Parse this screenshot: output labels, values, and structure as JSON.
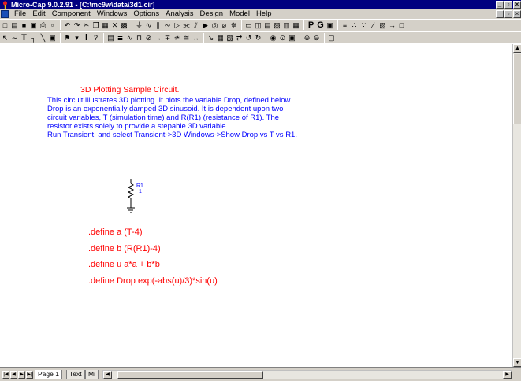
{
  "window": {
    "title": "Micro-Cap 9.0.2.91 - [C:\\mc9w\\data\\3d1.cir]",
    "buttons": [
      "_",
      "×"
    ]
  },
  "menubar": {
    "items": [
      "File",
      "Edit",
      "Component",
      "Windows",
      "Options",
      "Analysis",
      "Design",
      "Model",
      "Help"
    ],
    "mdi_buttons": [
      "_",
      "×"
    ]
  },
  "toolbar1": {
    "buttons": [
      {
        "name": "new-icon",
        "glyph": "□"
      },
      {
        "name": "open-icon",
        "glyph": "▤"
      },
      {
        "name": "save-icon",
        "glyph": "■"
      },
      {
        "name": "save-all-icon",
        "glyph": "▣"
      },
      {
        "name": "print-icon",
        "glyph": "⎙"
      },
      {
        "name": "print-preview-icon",
        "glyph": "▫"
      },
      {
        "name": "undo-icon",
        "glyph": "↶"
      },
      {
        "name": "redo-icon",
        "glyph": "↷"
      },
      {
        "name": "cut-icon",
        "glyph": "✂"
      },
      {
        "name": "copy-icon",
        "glyph": "❐"
      },
      {
        "name": "paste-icon",
        "glyph": "▦"
      },
      {
        "name": "delete-icon",
        "glyph": "✕"
      },
      {
        "name": "select-all-icon",
        "glyph": "▩"
      },
      {
        "name": "ground-icon",
        "glyph": "⏚"
      },
      {
        "name": "resistor-icon",
        "glyph": "∿"
      },
      {
        "name": "capacitor-icon",
        "glyph": "∥"
      },
      {
        "name": "inductor-icon",
        "glyph": "∾"
      },
      {
        "name": "diode-icon",
        "glyph": "▷"
      },
      {
        "name": "battery-icon",
        "glyph": "⫘"
      },
      {
        "name": "npn-icon",
        "glyph": "⫽"
      },
      {
        "name": "opamp-icon",
        "glyph": "▶"
      },
      {
        "name": "source-icon",
        "glyph": "◎"
      },
      {
        "name": "switch-icon",
        "glyph": "⌀"
      },
      {
        "name": "component-icon",
        "glyph": "✵"
      },
      {
        "name": "window-icon",
        "glyph": "▭"
      },
      {
        "name": "tile-icon",
        "glyph": "◫"
      },
      {
        "name": "cascade-icon",
        "glyph": "▤"
      },
      {
        "name": "component-browser-icon",
        "glyph": "▧"
      },
      {
        "name": "text-window-icon",
        "glyph": "▥"
      },
      {
        "name": "calculator-icon",
        "glyph": "▦"
      },
      {
        "name": "pin-icon",
        "glyph": "P",
        "bold": true
      },
      {
        "name": "grid-icon",
        "glyph": "G",
        "bold": true
      },
      {
        "name": "border-icon",
        "glyph": "▣"
      },
      {
        "name": "attribute-icon",
        "glyph": "≡"
      },
      {
        "name": "node-numbers-icon",
        "glyph": "∴"
      },
      {
        "name": "node-voltage-icon",
        "glyph": "∵"
      },
      {
        "name": "pin-marker-icon",
        "glyph": "∕"
      },
      {
        "name": "grid-text-icon",
        "glyph": "▨"
      },
      {
        "name": "current-icon",
        "glyph": "→"
      },
      {
        "name": "power-icon",
        "glyph": "□"
      }
    ]
  },
  "toolbar2": {
    "buttons": [
      {
        "name": "select-mode-icon",
        "glyph": "↖"
      },
      {
        "name": "wire-mode-icon",
        "glyph": "∼"
      },
      {
        "name": "text-mode-icon",
        "glyph": "T",
        "bold": true
      },
      {
        "name": "wire-icon",
        "glyph": "┐"
      },
      {
        "name": "diagonal-wire-icon",
        "glyph": "╲"
      },
      {
        "name": "info-mode-icon",
        "glyph": "▣"
      },
      {
        "name": "flag-icon",
        "glyph": "⚑"
      },
      {
        "name": "point-to-point-icon",
        "glyph": "▾"
      },
      {
        "name": "info-icon",
        "glyph": "i",
        "bold": true
      },
      {
        "name": "help-icon",
        "glyph": "?"
      },
      {
        "name": "step-icon",
        "glyph": "▤"
      },
      {
        "name": "text-icon",
        "glyph": "≣"
      },
      {
        "name": "waveform-icon",
        "glyph": "∿"
      },
      {
        "name": "pulse-icon",
        "glyph": "⊓"
      },
      {
        "name": "probe-icon",
        "glyph": "⊘"
      },
      {
        "name": "goal-icon",
        "glyph": "→"
      },
      {
        "name": "plus-icon",
        "glyph": "∓"
      },
      {
        "name": "tran-icon",
        "glyph": "≄"
      },
      {
        "name": "ac-icon",
        "glyph": "≅"
      },
      {
        "name": "dc-icon",
        "glyph": "↔"
      },
      {
        "name": "rotate-icon",
        "glyph": "↘"
      },
      {
        "name": "mirror-icon",
        "glyph": "▦"
      },
      {
        "name": "flip-icon",
        "glyph": "▧"
      },
      {
        "name": "undo-flip-icon",
        "glyph": "⇄"
      },
      {
        "name": "rotate-left-icon",
        "glyph": "↺"
      },
      {
        "name": "rotate-right-icon",
        "glyph": "↻"
      },
      {
        "name": "find-icon",
        "glyph": "◉"
      },
      {
        "name": "binoculars-icon",
        "glyph": "⊙"
      },
      {
        "name": "property-icon",
        "glyph": "▣"
      },
      {
        "name": "zoom-in-icon",
        "glyph": "⊕"
      },
      {
        "name": "zoom-out-icon",
        "glyph": "⊖"
      },
      {
        "name": "camera-icon",
        "glyph": "▢"
      }
    ]
  },
  "document": {
    "title": "3D Plotting Sample Circuit.",
    "description": [
      "This circuit illustrates 3D plotting. It plots the variable Drop, defined below.",
      "Drop is an exponentially damped 3D sinusoid.  It is dependent upon two",
      "circuit variables, T (simulation time) and R(R1) (resistance of R1). The",
      "resistor exists solely to provide a stepable 3D variable.",
      "Run Transient, and select Transient->3D Windows->Show Drop vs T vs R1."
    ],
    "resistor_label": "R1",
    "resistor_node": "1",
    "defines": [
      ".define a (T-4)",
      ".define b (R(R1)-4)",
      ".define u a*a + b*b",
      ".define Drop exp(-abs(u)/3)*sin(u)"
    ]
  },
  "bottom": {
    "nav": [
      "|◀",
      "◀",
      "▶",
      "▶|"
    ],
    "tabs": [
      "Page 1",
      "Text",
      "Mi"
    ]
  },
  "colors": {
    "title_red": "#ff0000",
    "text_blue": "#0000ff",
    "titlebar": "#000080",
    "chrome": "#d4d0c8"
  }
}
